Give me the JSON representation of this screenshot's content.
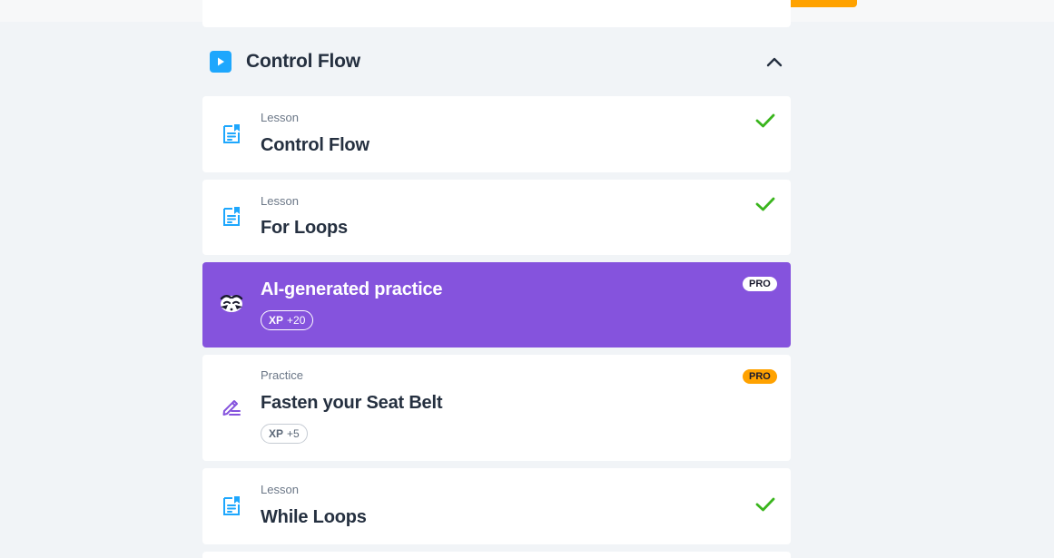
{
  "colors": {
    "page_bg": "#f1f4f7",
    "accent_blue": "#1ea7fd",
    "check_green": "#3ab51d",
    "ai_purple": "#8553dd",
    "pro_orange": "#ffa200"
  },
  "section": {
    "title": "Control Flow",
    "icon": "play-icon",
    "collapse_icon": "chevron-up-icon"
  },
  "items": [
    {
      "kind": "Lesson",
      "title": "Control Flow",
      "icon": "document-icon",
      "status": "completed"
    },
    {
      "kind": "Lesson",
      "title": "For Loops",
      "icon": "document-icon",
      "status": "completed"
    },
    {
      "kind": "",
      "title": "AI-generated practice",
      "icon": "ai-mascot-icon",
      "xp_label": "XP",
      "xp_value": "+20",
      "badge": "PRO"
    },
    {
      "kind": "Practice",
      "title": "Fasten your Seat Belt",
      "icon": "pencil-icon",
      "xp_label": "XP",
      "xp_value": "+5",
      "badge": "PRO"
    },
    {
      "kind": "Lesson",
      "title": "While Loops",
      "icon": "document-icon",
      "status": "completed"
    }
  ]
}
